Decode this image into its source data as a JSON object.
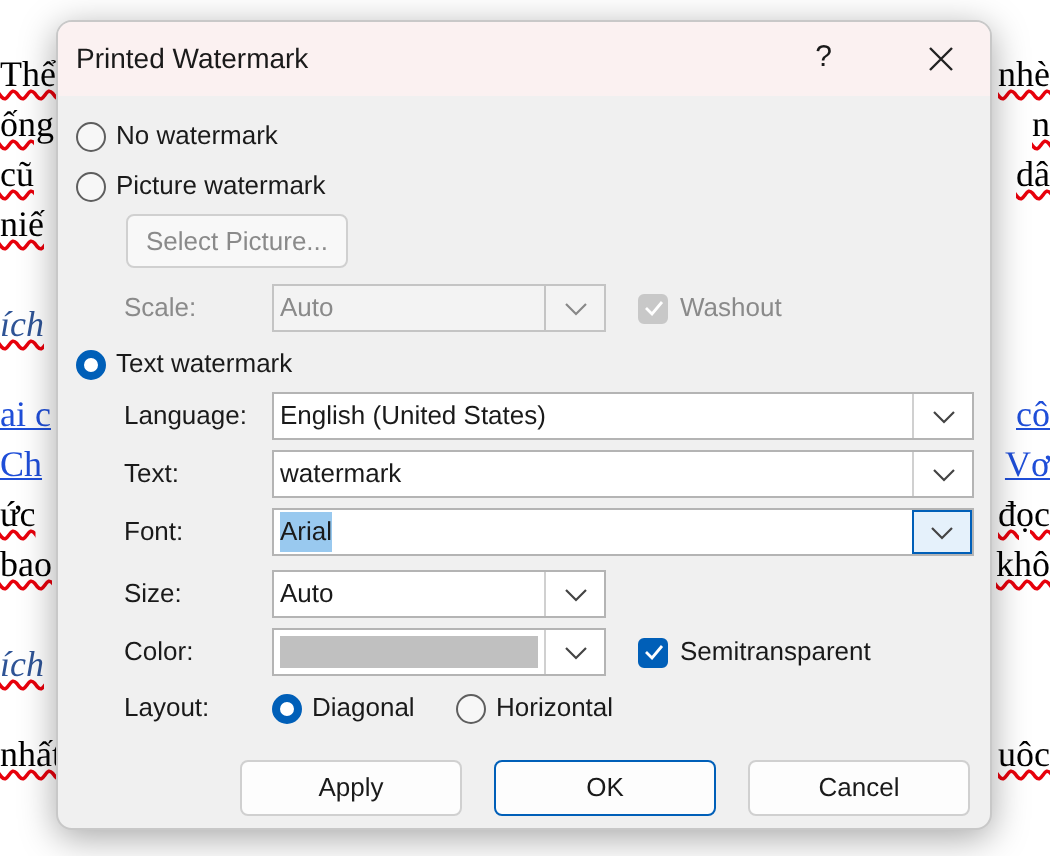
{
  "document": {
    "lines": [
      {
        "kind": "text",
        "left": "Thể",
        "right": "nhè"
      },
      {
        "kind": "text",
        "left": "ống",
        "right": "n"
      },
      {
        "kind": "text",
        "left": "cũ",
        "right": "dâ"
      },
      {
        "kind": "text",
        "left": "niế"
      },
      {
        "kind": "heading",
        "left": "ích"
      },
      {
        "kind": "link",
        "left": "ai c",
        "right": "cô"
      },
      {
        "kind": "link",
        "left": "Ch",
        "right": "Vơ"
      },
      {
        "kind": "text",
        "left": "ức",
        "right": "đọc"
      },
      {
        "kind": "text",
        "left": "bao",
        "right": "khô"
      },
      {
        "kind": "heading",
        "left": "ích"
      },
      {
        "kind": "text",
        "left": "nhất",
        "right": "uôc"
      }
    ]
  },
  "dialog": {
    "title": "Printed Watermark",
    "help": "?",
    "watermark_types": [
      {
        "label": "No watermark",
        "selected": false
      },
      {
        "label": "Picture watermark",
        "selected": false
      },
      {
        "label": "Text watermark",
        "selected": true
      }
    ],
    "picture_options": {
      "select_button": {
        "label": "Select Picture...",
        "disabled": true
      },
      "scale": {
        "label": "Scale:",
        "value": "Auto",
        "disabled": true
      },
      "washout": {
        "label": "Washout",
        "checked": true,
        "disabled": true
      }
    },
    "text_options": {
      "fields": [
        {
          "kind": "wide",
          "label": "Language:",
          "value": "English (United States)",
          "focused": false
        },
        {
          "kind": "wide",
          "label": "Text:",
          "value": "watermark",
          "focused": false
        },
        {
          "kind": "wide",
          "label": "Font:",
          "value": "Arial",
          "focused": true
        },
        {
          "kind": "narrow",
          "label": "Size:",
          "value": "Auto",
          "focused": false
        },
        {
          "kind": "color",
          "label": "Color:",
          "color": "#c0c0c0",
          "focused": false
        }
      ],
      "semitransparent": {
        "label": "Semitransparent",
        "checked": true,
        "disabled": false
      },
      "layout": {
        "label": "Layout:",
        "options": [
          {
            "label": "Diagonal",
            "selected": true
          },
          {
            "label": "Horizontal",
            "selected": false
          }
        ]
      }
    },
    "buttons": [
      {
        "label": "Apply",
        "default": false
      },
      {
        "label": "OK",
        "default": true
      },
      {
        "label": "Cancel",
        "default": false
      }
    ]
  }
}
